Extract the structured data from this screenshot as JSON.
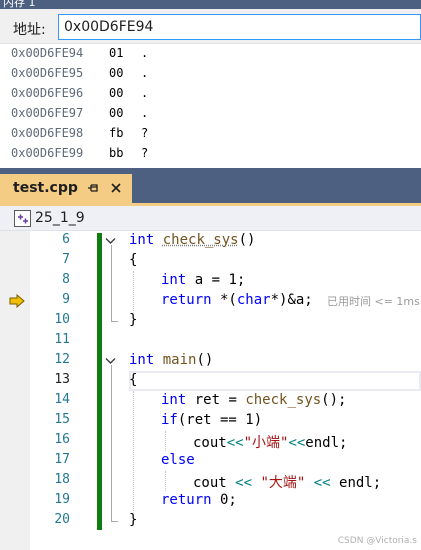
{
  "memory": {
    "title": "内存 1",
    "address_label": "地址:",
    "address_value": "0x00D6FE94",
    "rows": [
      {
        "address": "0x00D6FE94",
        "hex": "01",
        "ascii": "."
      },
      {
        "address": "0x00D6FE95",
        "hex": "00",
        "ascii": "."
      },
      {
        "address": "0x00D6FE96",
        "hex": "00",
        "ascii": "."
      },
      {
        "address": "0x00D6FE97",
        "hex": "00",
        "ascii": "."
      },
      {
        "address": "0x00D6FE98",
        "hex": "fb",
        "ascii": "?"
      },
      {
        "address": "0x00D6FE99",
        "hex": "bb",
        "ascii": "?"
      }
    ]
  },
  "editor": {
    "tab_name": "test.cpp",
    "project_name": "25_1_9",
    "perf_tip": "已用时间 <= 1ms",
    "line_numbers": [
      "6",
      "7",
      "8",
      "9",
      "10",
      "11",
      "12",
      "13",
      "14",
      "15",
      "16",
      "17",
      "18",
      "19",
      "20"
    ],
    "code": {
      "l6_kw": "int",
      "l6_fn": "check_sys",
      "l6_rest": "()",
      "l7": "{",
      "l8_kw": "int",
      "l8_rest": " a = 1;",
      "l9_kw": "return",
      "l9_a": " *(",
      "l9_kw2": "char",
      "l9_b": "*)&a;",
      "l10": "}",
      "l12_kw": "int",
      "l12_fn": "main",
      "l12_rest": "()",
      "l13": "{",
      "l14_kw": "int",
      "l14_a": " ret = ",
      "l14_fn": "check_sys",
      "l14_b": "();",
      "l15_kw": "if",
      "l15_rest": "(ret == 1)",
      "l16_a": "cout",
      "l16_op": "<<",
      "l16_str": "\"小端\"",
      "l16_op2": "<<",
      "l16_b": "endl;",
      "l17_kw": "else",
      "l18_a": "cout ",
      "l18_op": "<<",
      "l18_str": " \"大端\" ",
      "l18_op2": "<<",
      "l18_b": " endl;",
      "l19_kw": "return",
      "l19_rest": " 0;",
      "l20": "}"
    }
  },
  "icons": {
    "tab_pin": "pin-icon",
    "tab_close": "close-icon",
    "project": "project-icon",
    "next_statement": "next-statement-arrow-icon",
    "fold": "chevron-down-icon"
  },
  "colors": {
    "title_bar": "#4d6082",
    "active_tab": "#f5cc84",
    "keyword": "#0000ff",
    "function": "#74531f",
    "string": "#a31515",
    "operator": "#008080",
    "change_bar": "#107c10",
    "arrow": "#f0c000"
  },
  "watermark": "CSDN @Victoria.s"
}
